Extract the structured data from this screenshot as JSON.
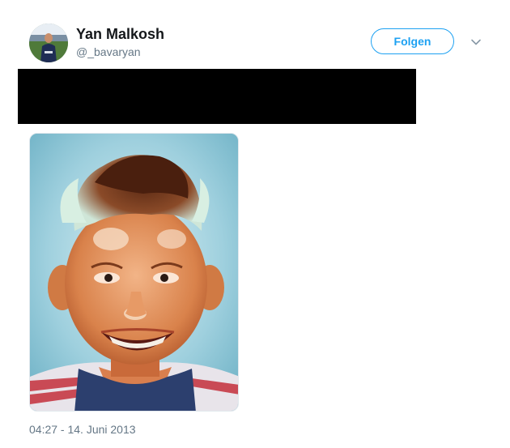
{
  "tweet": {
    "author_name": "Yan Malkosh",
    "author_handle": "@_bavaryan",
    "follow_label": "Folgen",
    "timestamp": "04:27 - 14. Juni 2013",
    "colors": {
      "accent": "#1da1f2",
      "secondary_text": "#657786",
      "primary_text": "#14171a",
      "redaction": "#000000"
    },
    "icons": {
      "menu": "chevron-down-icon"
    }
  }
}
